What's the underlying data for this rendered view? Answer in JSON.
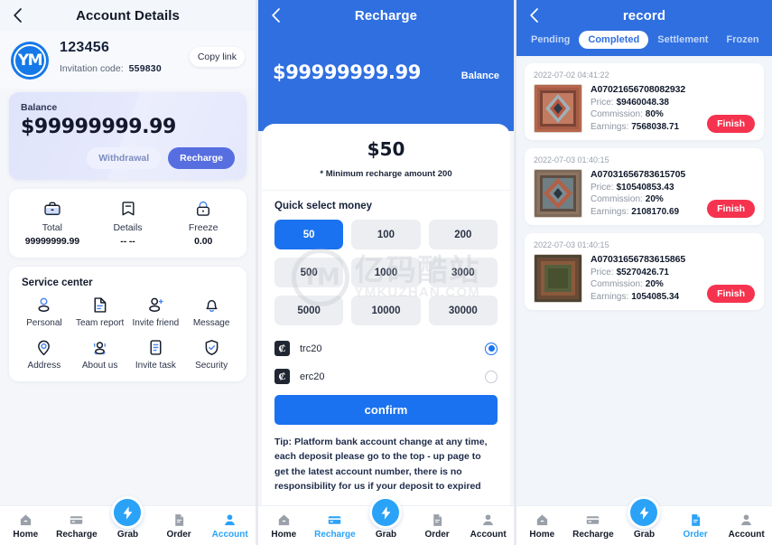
{
  "colors": {
    "brand_blue": "#2f6fe0",
    "accent_blue": "#1b72f0",
    "tab_active": "#2aa2f7",
    "finish_red": "#f5334e",
    "page_bg": "#f4f6fa"
  },
  "panel1": {
    "header": {
      "title": "Account Details",
      "back_icon": "chevron-left-icon"
    },
    "account": {
      "avatar_text": "YM",
      "uid": "123456",
      "invitation_label": "Invitation code:",
      "invitation_code": "559830",
      "copy_link": "Copy link"
    },
    "balance_card": {
      "label": "Balance",
      "amount": "$99999999.99",
      "withdrawal_label": "Withdrawal",
      "recharge_label": "Recharge"
    },
    "stats": [
      {
        "icon": "briefcase-icon",
        "name": "Total",
        "value": "99999999.99"
      },
      {
        "icon": "bookmark-icon",
        "name": "Details",
        "value": "-- --"
      },
      {
        "icon": "lock-icon",
        "name": "Freeze",
        "value": "0.00"
      }
    ],
    "service_center": {
      "title": "Service center",
      "items": [
        {
          "icon": "person-icon",
          "label": "Personal"
        },
        {
          "icon": "document-icon",
          "label": "Team report"
        },
        {
          "icon": "person-add-icon",
          "label": "Invite friend"
        },
        {
          "icon": "bell-icon",
          "label": "Message"
        },
        {
          "icon": "location-pin-icon",
          "label": "Address"
        },
        {
          "icon": "people-icon",
          "label": "About us"
        },
        {
          "icon": "list-doc-icon",
          "label": "Invite task"
        },
        {
          "icon": "shield-check-icon",
          "label": "Security"
        }
      ]
    },
    "tabbar": {
      "active": "Account",
      "items": [
        {
          "icon": "home-icon",
          "label": "Home"
        },
        {
          "icon": "card-icon",
          "label": "Recharge"
        },
        {
          "icon": "bolt-icon",
          "label": "Grab"
        },
        {
          "icon": "file-icon",
          "label": "Order"
        },
        {
          "icon": "user-icon",
          "label": "Account"
        }
      ]
    }
  },
  "panel2": {
    "header": {
      "title": "Recharge",
      "back_icon": "chevron-left-icon"
    },
    "balance": {
      "amount": "$99999999.99",
      "label": "Balance"
    },
    "amount_box": {
      "value": "$50",
      "min_note": "* Minimum recharge amount 200"
    },
    "quick_select": {
      "title": "Quick select money",
      "selected": "50",
      "options": [
        "50",
        "100",
        "200",
        "500",
        "1000",
        "3000",
        "5000",
        "10000",
        "30000"
      ]
    },
    "payments": {
      "selected": "trc20",
      "options": [
        {
          "icon": "coin-icon",
          "name": "trc20",
          "selected": true
        },
        {
          "icon": "coin-icon",
          "name": "erc20",
          "selected": false
        }
      ]
    },
    "confirm_label": "confirm",
    "tip": "Tip: Platform bank account change at any time, each deposit please go to the top - up page to get the latest account number, there is no responsibility for us if your deposit to expired",
    "watermark": {
      "mark": "YM",
      "cn": "亿码酷站",
      "en": "YMKUZHAN.COM"
    },
    "tabbar": {
      "active": "Recharge",
      "items": [
        {
          "icon": "home-icon",
          "label": "Home"
        },
        {
          "icon": "card-icon",
          "label": "Recharge"
        },
        {
          "icon": "bolt-icon",
          "label": "Grab"
        },
        {
          "icon": "file-icon",
          "label": "Order"
        },
        {
          "icon": "user-icon",
          "label": "Account"
        }
      ]
    }
  },
  "panel3": {
    "header": {
      "title": "record",
      "back_icon": "chevron-left-icon"
    },
    "tabs": [
      {
        "label": "Pending",
        "active": false
      },
      {
        "label": "Completed",
        "active": true
      },
      {
        "label": "Settlement",
        "active": false
      },
      {
        "label": "Frozen",
        "active": false
      }
    ],
    "labels": {
      "price": "Price:",
      "commission": "Commission:",
      "earnings": "Earnings:",
      "action": "Finish"
    },
    "records": [
      {
        "time": "2022-07-02 04:41:22",
        "id": "A07021656708082932",
        "price": "$9460048.38",
        "commission": "80%",
        "earnings": "7568038.71",
        "action": "Finish",
        "thumb": "persian-rug-medallion-red"
      },
      {
        "time": "2022-07-03 01:40:15",
        "id": "A07031656783615705",
        "price": "$10540853.43",
        "commission": "20%",
        "earnings": "2108170.69",
        "action": "Finish",
        "thumb": "persian-rug-diamond-blue"
      },
      {
        "time": "2022-07-03 01:40:15",
        "id": "A07031656783615865",
        "price": "$5270426.71",
        "commission": "20%",
        "earnings": "1054085.34",
        "action": "Finish",
        "thumb": "persian-rug-dark-green"
      }
    ],
    "tabbar": {
      "active": "Order",
      "items": [
        {
          "icon": "home-icon",
          "label": "Home"
        },
        {
          "icon": "card-icon",
          "label": "Recharge"
        },
        {
          "icon": "bolt-icon",
          "label": "Grab"
        },
        {
          "icon": "file-icon",
          "label": "Order"
        },
        {
          "icon": "user-icon",
          "label": "Account"
        }
      ]
    }
  }
}
